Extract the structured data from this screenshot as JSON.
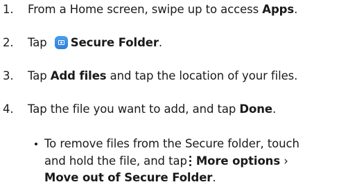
{
  "steps": [
    {
      "number": "1.",
      "text_a": "From a Home screen, swipe up to access ",
      "bold_a": "Apps",
      "text_b": "."
    },
    {
      "number": "2.",
      "text_a": "Tap",
      "icon": "secure-folder-icon",
      "bold_a": "Secure Folder",
      "text_b": "."
    },
    {
      "number": "3.",
      "text_a": "Tap ",
      "bold_a": "Add files",
      "text_b": " and tap the location of your files."
    },
    {
      "number": "4.",
      "text_a": "Tap the file you want to add, and tap ",
      "bold_a": "Done",
      "text_b": "."
    }
  ],
  "bullet": {
    "line1": "To remove files from the Secure folder, touch",
    "line2_a": "and hold the file, and tap",
    "icon": "more-options-icon",
    "line2_bold": "More options",
    "line2_sep": " ›",
    "line3_bold": "Move out of Secure Folder",
    "line3_b": "."
  },
  "colors": {
    "text": "#1a1a1a",
    "secure_folder_icon": "#3a8fe8"
  }
}
